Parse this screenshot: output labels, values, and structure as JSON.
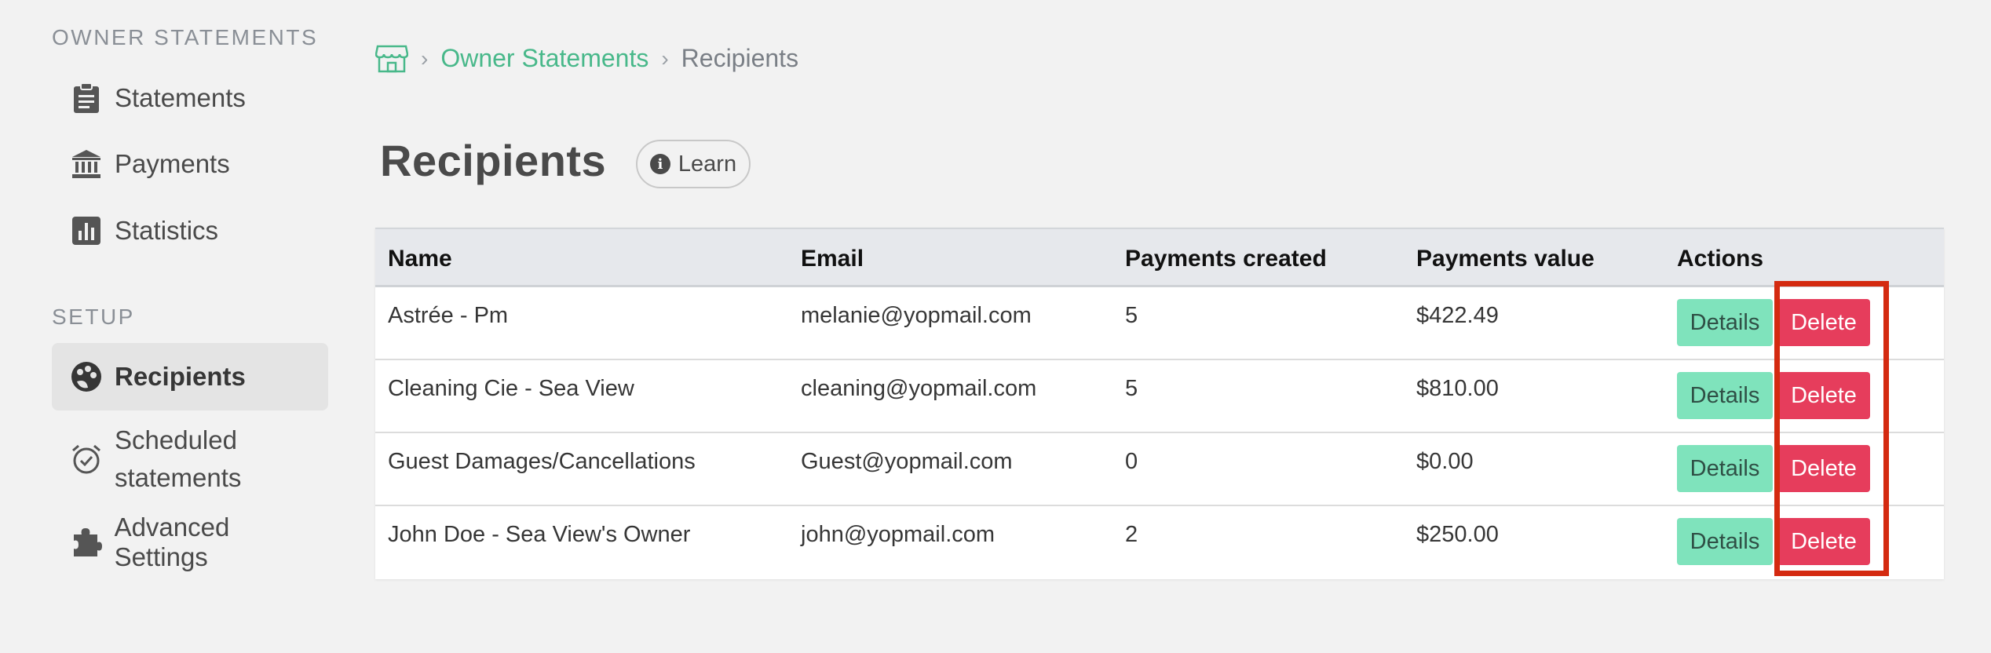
{
  "sidebar": {
    "section_owner": "OWNER STATEMENTS",
    "items_owner": [
      {
        "label": "Statements",
        "icon": "clipboard-icon"
      },
      {
        "label": "Payments",
        "icon": "bank-icon"
      },
      {
        "label": "Statistics",
        "icon": "chart-icon"
      }
    ],
    "section_setup": "SETUP",
    "items_setup": [
      {
        "label": "Recipients",
        "icon": "palette-icon",
        "active": true
      },
      {
        "label_line1": "Scheduled",
        "label_line2": "statements",
        "icon": "alarm-clock-icon"
      },
      {
        "label": "Advanced Settings",
        "icon": "puzzle-icon"
      }
    ]
  },
  "breadcrumb": {
    "home_icon": "store-icon",
    "link": "Owner Statements",
    "current": "Recipients"
  },
  "header": {
    "title": "Recipients",
    "learn_label": "Learn"
  },
  "table": {
    "columns": [
      "Name",
      "Email",
      "Payments created",
      "Payments value",
      "Actions"
    ],
    "rows": [
      {
        "name": "Astrée - Pm",
        "email": "melanie@yopmail.com",
        "created": "5",
        "value": "$422.49"
      },
      {
        "name": "Cleaning Cie - Sea View",
        "email": "cleaning@yopmail.com",
        "created": "5",
        "value": "$810.00"
      },
      {
        "name": "Guest Damages/Cancellations",
        "email": "Guest@yopmail.com",
        "created": "0",
        "value": "$0.00"
      },
      {
        "name": "John Doe - Sea View's Owner",
        "email": "john@yopmail.com",
        "created": "2",
        "value": "$250.00"
      }
    ],
    "details_label": "Details",
    "delete_label": "Delete"
  },
  "colors": {
    "accent_green": "#48b88a",
    "details_button": "#7fe3bc",
    "delete_button": "#e63d5c",
    "highlight": "#d42a10"
  }
}
